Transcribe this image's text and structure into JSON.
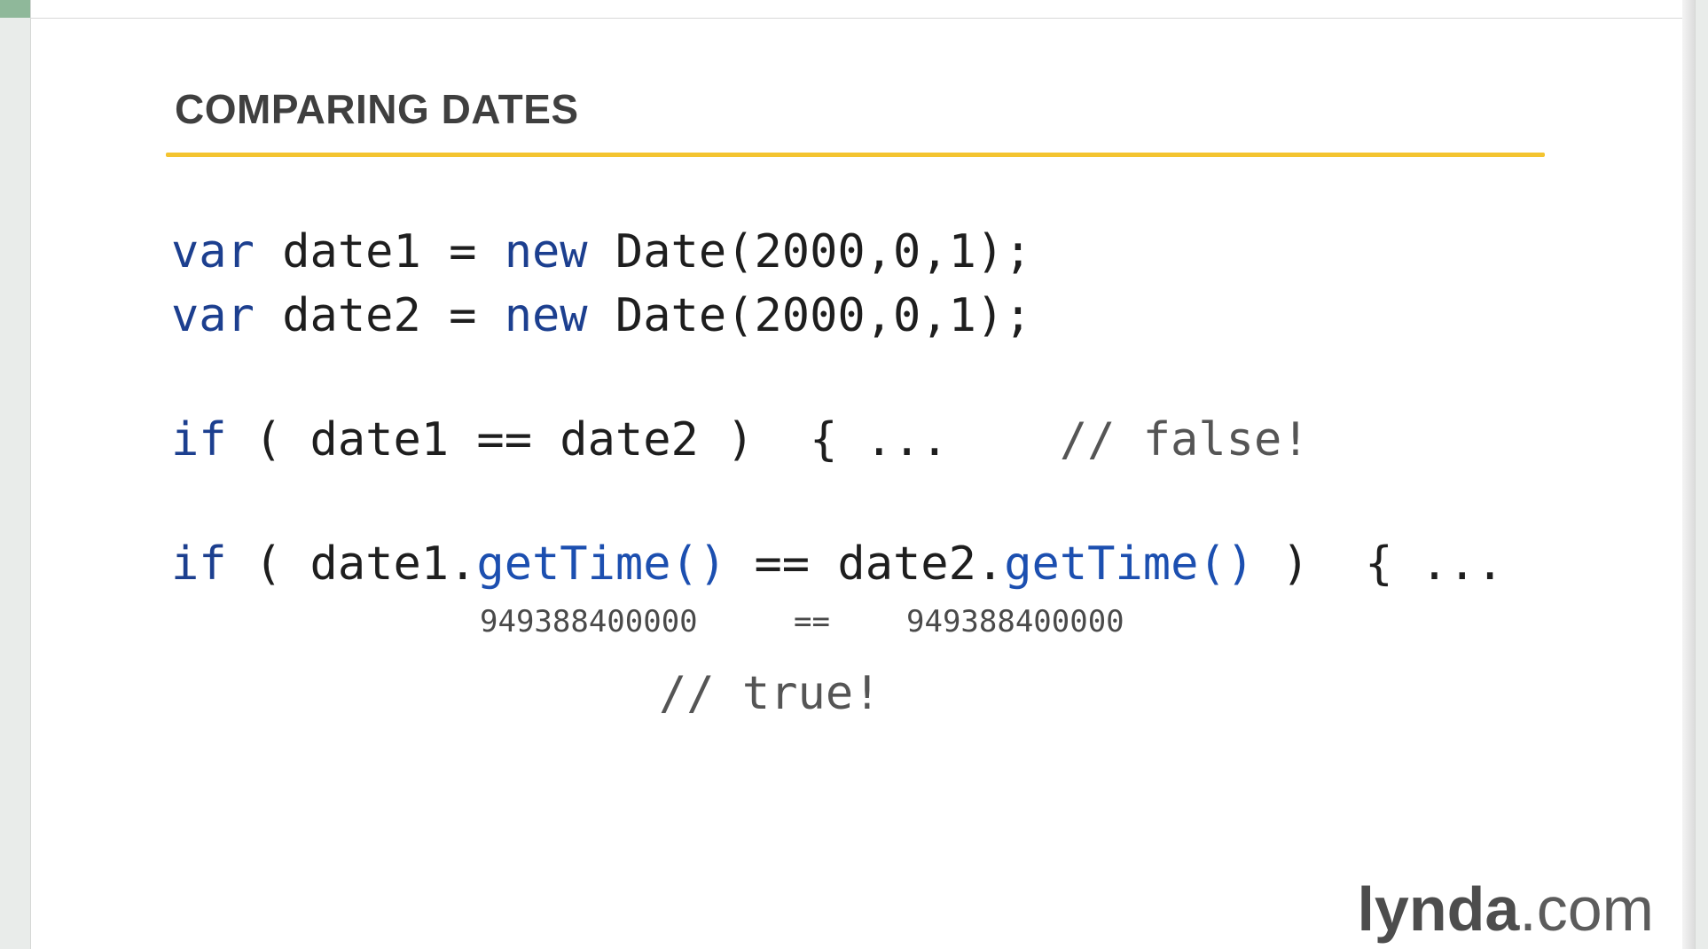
{
  "slide": {
    "title": "COMPARING DATES",
    "accent_color": "#f4c430"
  },
  "code": {
    "line1": {
      "kw_var": "var",
      "ident": " date1 = ",
      "kw_new": "new",
      "rest": " Date(2000,0,1);"
    },
    "line2": {
      "kw_var": "var",
      "ident": " date2 = ",
      "kw_new": "new",
      "rest": " Date(2000,0,1);"
    },
    "line3": {
      "kw_if": "if",
      "body": " ( date1 == date2 )  { ...    ",
      "comment": "// false!"
    },
    "line4": {
      "kw_if": "if",
      "part1": " ( date1.",
      "fn1": "getTime()",
      "part2": " == date2.",
      "fn2": "getTime()",
      "part3": " )  { ..."
    },
    "annotation": {
      "left_value": "949388400000",
      "operator": "==",
      "right_value": "949388400000"
    },
    "result_comment": "// true!"
  },
  "branding": {
    "brand": "lynda",
    "tld": ".com"
  }
}
